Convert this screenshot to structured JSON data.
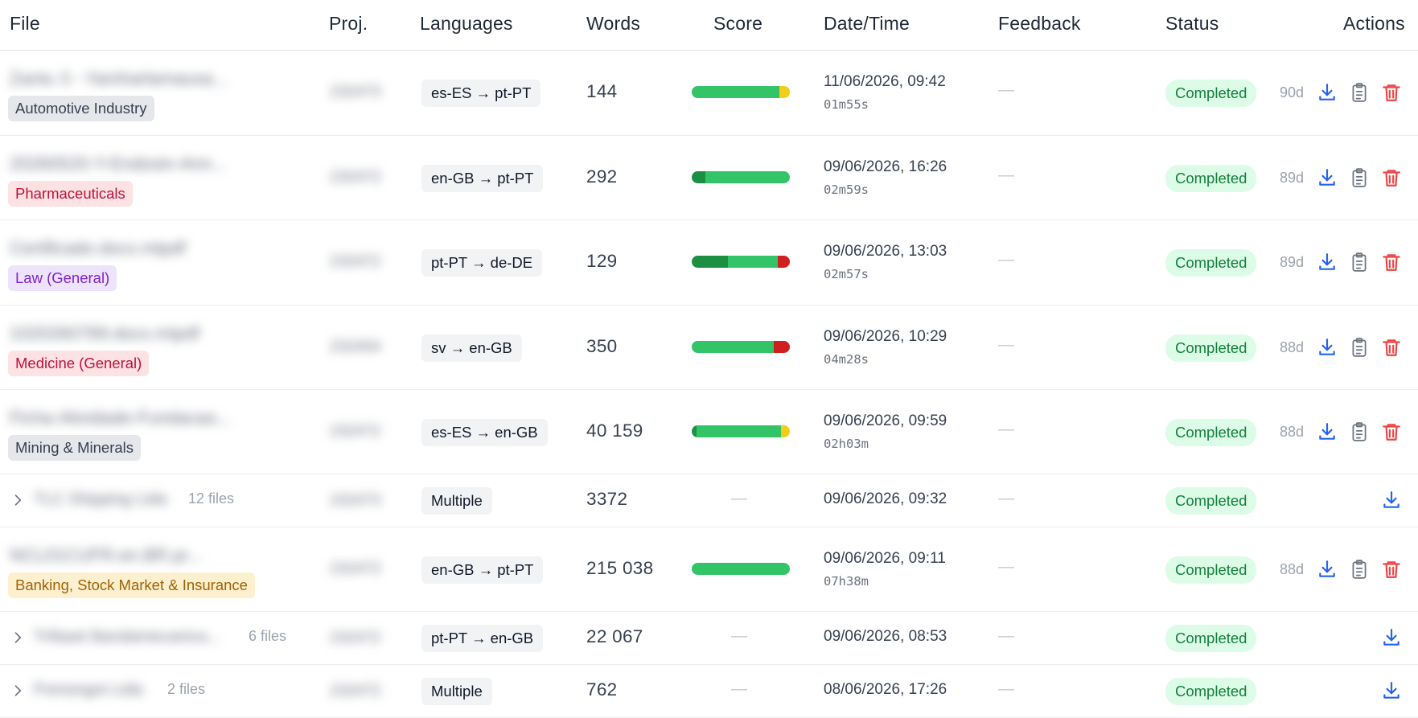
{
  "colors": {
    "score_green": "#33c468",
    "score_dark_green": "#1d8f43",
    "score_yellow": "#f3cd17",
    "score_red": "#cf1f1f",
    "status_bg": "#dcfce7",
    "status_text": "#15803d",
    "download_icon": "#2563eb",
    "delete_icon": "#ef4444"
  },
  "header": {
    "file": "File",
    "proj": "Proj.",
    "languages": "Languages",
    "words": "Words",
    "score": "Score",
    "datetime": "Date/Time",
    "feedback": "Feedback",
    "status": "Status",
    "actions": "Actions"
  },
  "rows": [
    {
      "name": "Zantu 3 - Yamharlamausa...",
      "proj": "232473",
      "tag": "Automotive Industry",
      "lang": "es-ES → pt-PT",
      "words": "144",
      "date": "11/06/2026, 09:42",
      "duration": "01m55s",
      "feedback": "—",
      "status": "Completed",
      "days": "90d",
      "score": [
        0,
        0.89,
        0.11,
        0
      ]
    },
    {
      "name": "20260520-Y-Endosin-Ann...",
      "proj": "232472",
      "tag": "Pharmaceuticals",
      "lang": "en-GB → pt-PT",
      "words": "292",
      "date": "09/06/2026, 16:26",
      "duration": "02m59s",
      "feedback": "—",
      "status": "Completed",
      "days": "89d",
      "score": [
        0.14,
        0.86,
        0,
        0
      ]
    },
    {
      "name": "Certificado.docx.mtpdf",
      "proj": "232472",
      "tag": "Law (General)",
      "lang": "pt-PT → de-DE",
      "words": "129",
      "date": "09/06/2026, 13:03",
      "duration": "02m57s",
      "feedback": "—",
      "status": "Completed",
      "days": "89d",
      "score": [
        0.37,
        0.51,
        0,
        0.12
      ]
    },
    {
      "name": "1020260789.docx.mtpdf",
      "proj": "232404",
      "tag": "Medicine (General)",
      "lang": "sv → en-GB",
      "words": "350",
      "date": "09/06/2026, 10:29",
      "duration": "04m28s",
      "feedback": "—",
      "status": "Completed",
      "days": "88d",
      "score": [
        0,
        0.84,
        0,
        0.16
      ]
    },
    {
      "name": "Ficha-Atividade-Fundacao...",
      "proj": "232472",
      "tag": "Mining & Minerals",
      "lang": "es-ES → en-GB",
      "words": "40 159",
      "date": "09/06/2026, 09:59",
      "duration": "02h03m",
      "feedback": "—",
      "status": "Completed",
      "days": "88d",
      "score": [
        0.05,
        0.86,
        0.09,
        0
      ]
    },
    {
      "name": "TLC Shipping Ltda",
      "files": "12 files",
      "proj": "232473",
      "lang": "Multiple",
      "words": "3372",
      "score_text": "—",
      "date": "09/06/2026, 09:32",
      "feedback": "—",
      "status": "Completed"
    },
    {
      "name": "NCL01CUFR.en.BR.pr...",
      "proj": "232472",
      "tag": "Banking, Stock Market & Insurance",
      "lang": "en-GB → pt-PT",
      "words": "215 038",
      "date": "09/06/2026, 09:11",
      "duration": "07h38m",
      "feedback": "—",
      "status": "Completed",
      "days": "88d",
      "score": [
        0,
        1,
        0,
        0
      ]
    },
    {
      "name": "Trifaset Bandamecanica...",
      "files": "6 files",
      "proj": "232472",
      "lang": "pt-PT → en-GB",
      "words": "22 067",
      "score_text": "—",
      "date": "09/06/2026, 08:53",
      "feedback": "—",
      "status": "Completed"
    },
    {
      "name": "Pomongot Ltda",
      "files": "2 files",
      "proj": "232472",
      "lang": "Multiple",
      "words": "762",
      "score_text": "—",
      "date": "08/06/2026, 17:26",
      "feedback": "—",
      "status": "Completed"
    }
  ]
}
